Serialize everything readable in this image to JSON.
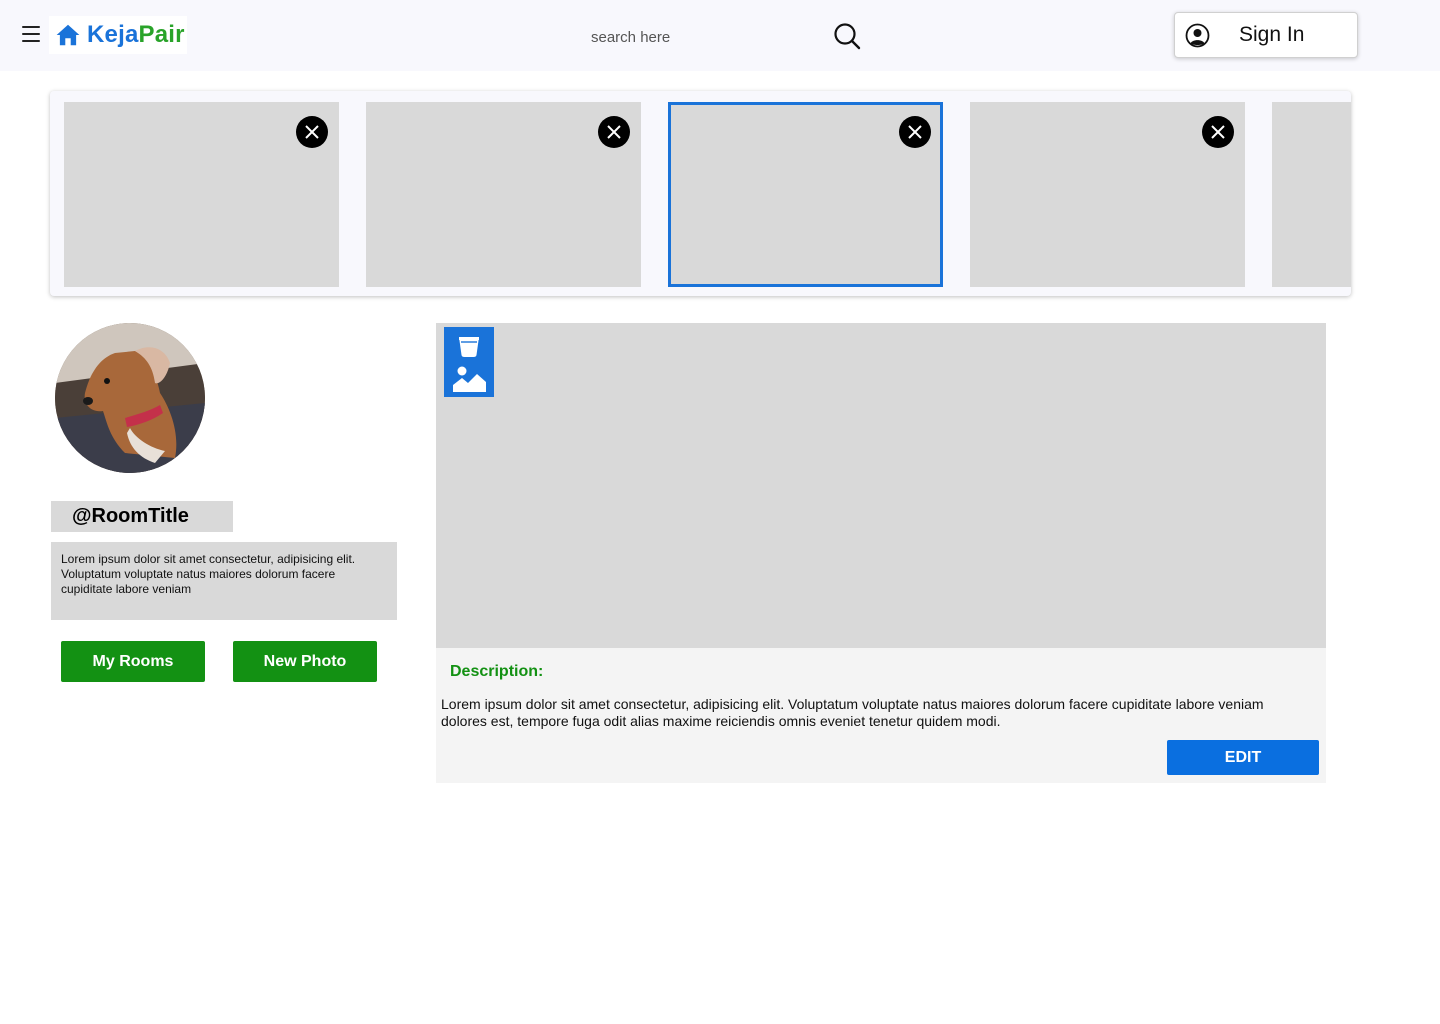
{
  "header": {
    "brand_part1": "Keja",
    "brand_part2": "Pair",
    "search_placeholder": "search here",
    "signin_label": "Sign In"
  },
  "carousel": {
    "thumbnails": [
      {
        "selected": false
      },
      {
        "selected": false
      },
      {
        "selected": true
      },
      {
        "selected": false
      },
      {
        "selected": false
      }
    ]
  },
  "profile": {
    "room_title": "@RoomTitle",
    "room_description": "Lorem ipsum dolor sit amet consectetur, adipisicing elit. Voluptatum voluptate natus maiores dolorum facere cupiditate labore veniam",
    "my_rooms_label": "My Rooms",
    "new_photo_label": "New Photo"
  },
  "detail": {
    "description_heading": "Description:",
    "description_text": "Lorem ipsum dolor sit amet consectetur, adipisicing elit. Voluptatum voluptate natus maiores dolorum facere cupiditate labore veniam dolores est, tempore fuga odit alias maxime reiciendis omnis eveniet tenetur quidem modi.",
    "edit_label": "EDIT"
  },
  "colors": {
    "brand_blue": "#1a73d9",
    "brand_green": "#29a329",
    "button_green": "#139113",
    "edit_blue": "#0a6fe0",
    "placeholder_gray": "#d9d9d9"
  },
  "icons": [
    "menu-icon",
    "house-icon",
    "search-icon",
    "user-circle-icon",
    "close-icon",
    "trash-icon",
    "image-icon"
  ]
}
